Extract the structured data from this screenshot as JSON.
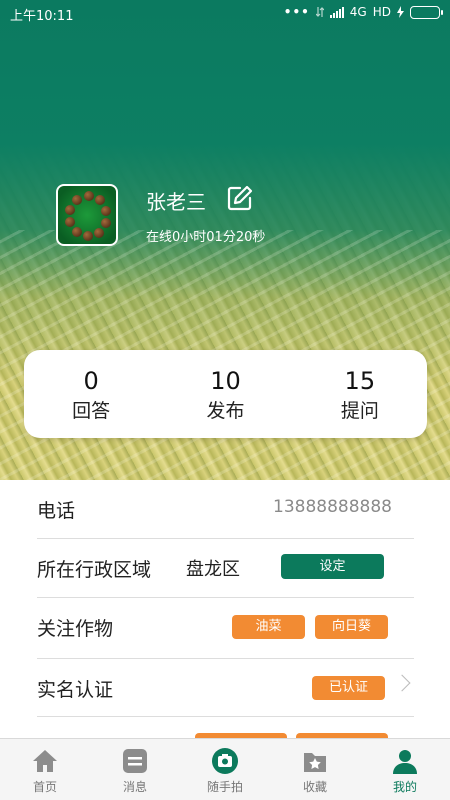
{
  "status_bar": {
    "time": "上午10:11",
    "network": "4G",
    "hd": "HD"
  },
  "profile": {
    "name": "张老三",
    "online_time": "在线0小时01分20秒"
  },
  "stats": [
    {
      "value": "0",
      "label": "回答"
    },
    {
      "value": "10",
      "label": "发布"
    },
    {
      "value": "15",
      "label": "提问"
    }
  ],
  "rows": {
    "phone_label": "电话",
    "phone_value": "13888888888",
    "region_label": "所在行政区域",
    "region_value": "盘龙区",
    "region_button": "设定",
    "crops_label": "关注作物",
    "crops": [
      "油菜",
      "向日葵"
    ],
    "verify_label": "实名认证",
    "verify_status": "已认证"
  },
  "tabs": [
    {
      "label": "首页",
      "icon": "home-icon"
    },
    {
      "label": "消息",
      "icon": "message-icon"
    },
    {
      "label": "随手拍",
      "icon": "camera-icon"
    },
    {
      "label": "收藏",
      "icon": "favorite-icon"
    },
    {
      "label": "我的",
      "icon": "user-icon"
    }
  ],
  "colors": {
    "primary": "#0c7a5c",
    "accent": "#f28b33"
  }
}
